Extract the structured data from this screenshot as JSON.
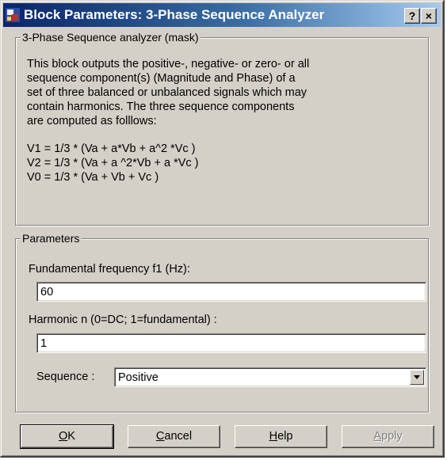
{
  "window": {
    "title": "Block Parameters: 3-Phase Sequence Analyzer",
    "help_glyph": "?",
    "close_glyph": "×"
  },
  "mask_group": {
    "legend": "3-Phase Sequence analyzer (mask)",
    "description_lines": [
      "This block outputs the positive-,  negative- or zero- or all",
      "sequence component(s) (Magnitude and Phase)  of a",
      "set of three balanced or unbalanced signals  which may",
      "contain harmonics. The three sequence components",
      "are computed as folllows:"
    ],
    "formula_lines": [
      "V1 = 1/3 * (Va + a*Vb  + a^2 *Vc )",
      "V2 = 1/3 * (Va + a ^2*Vb  +  a *Vc )",
      "V0 = 1/3 * (Va +  Vb  +  Vc )"
    ]
  },
  "params_group": {
    "legend": "Parameters",
    "freq_label": "Fundamental frequency f1 (Hz):",
    "freq_value": "60",
    "harmonic_label": "Harmonic n (0=DC; 1=fundamental) :",
    "harmonic_value": "1",
    "sequence_label": "Sequence :",
    "sequence_value": "Positive"
  },
  "buttons": {
    "ok": {
      "mnemonic": "O",
      "rest": "K"
    },
    "cancel": {
      "mnemonic": "C",
      "rest": "ancel"
    },
    "help": {
      "mnemonic": "H",
      "rest": "elp"
    },
    "apply": {
      "mnemonic": "A",
      "rest": "pply"
    }
  },
  "icons": {
    "app": "simulink-block-icon",
    "help": "help-icon",
    "close": "close-icon",
    "dropdown": "chevron-down-icon"
  }
}
